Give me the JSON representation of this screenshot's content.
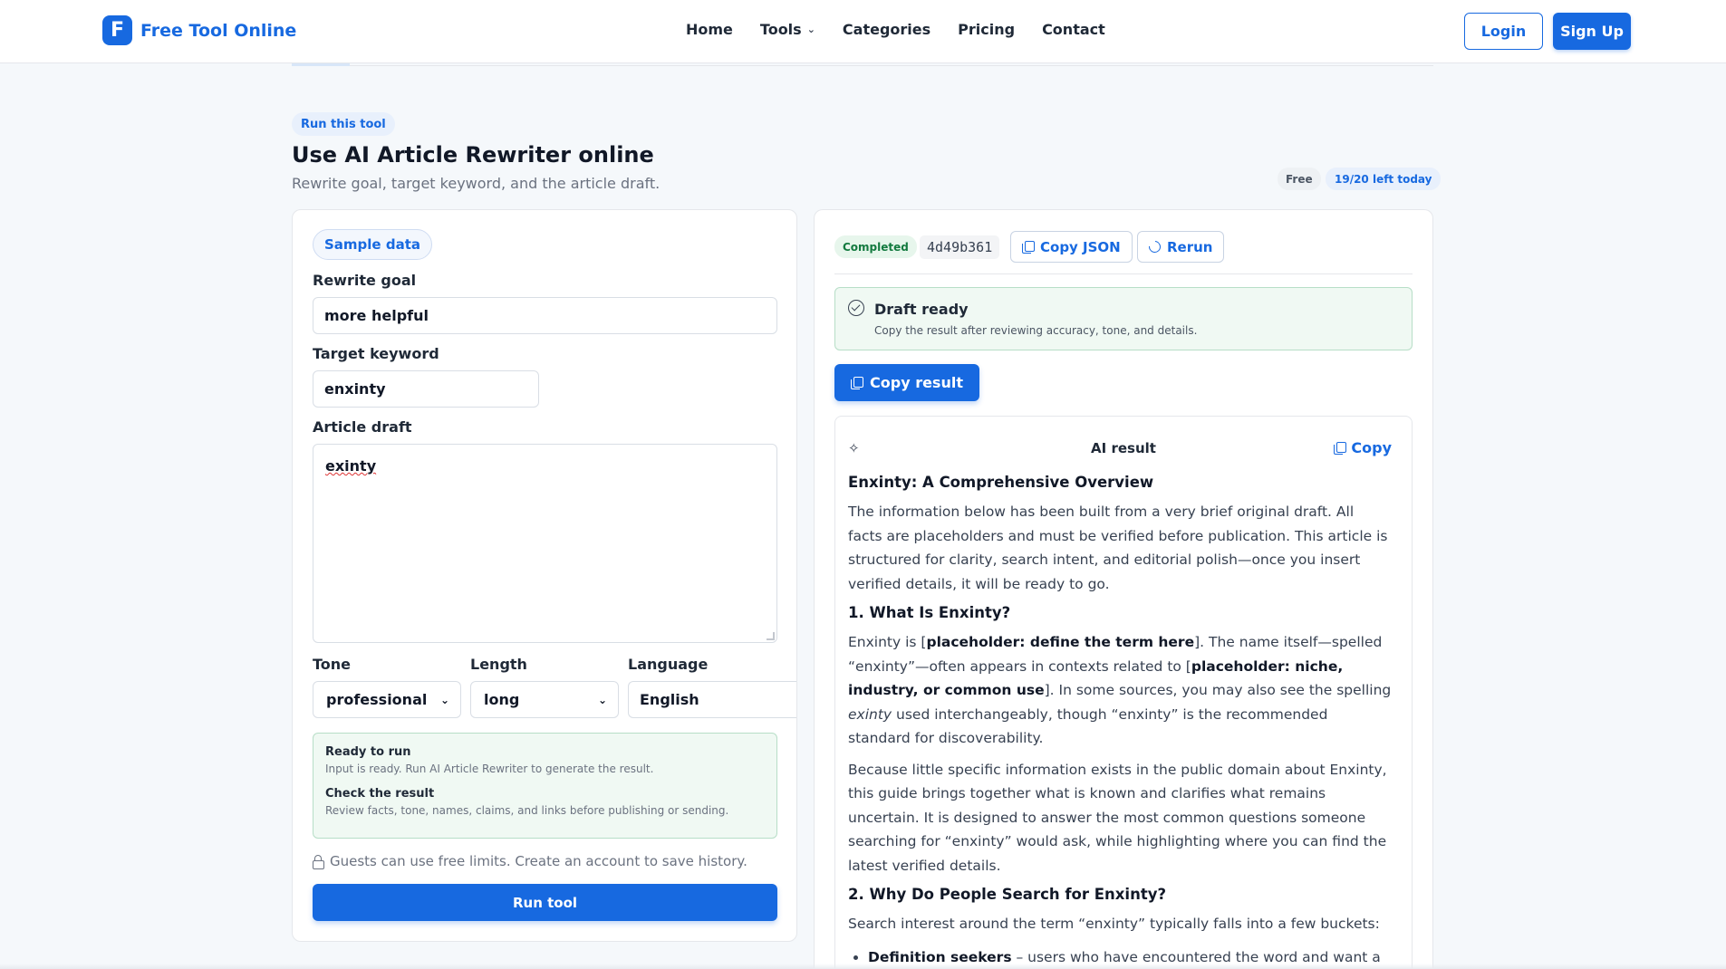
{
  "header": {
    "brand_letter": "F",
    "brand_name": "Free Tool Online",
    "nav": [
      {
        "label": "Home"
      },
      {
        "label": "Tools"
      },
      {
        "label": "Categories"
      },
      {
        "label": "Pricing"
      },
      {
        "label": "Contact"
      }
    ],
    "login_label": "Login",
    "signup_label": "Sign Up"
  },
  "hero": {
    "pill": "Run this tool",
    "title": "Use AI Article Rewriter online",
    "subtitle": "Rewrite goal, target keyword, and the article draft.",
    "badge_free": "Free",
    "badge_left": "19/20 left today"
  },
  "form": {
    "sample_label": "Sample data",
    "rewrite_goal_label": "Rewrite goal",
    "rewrite_goal_value": "more helpful",
    "target_keyword_label": "Target keyword",
    "target_keyword_value": "enxinty",
    "article_draft_label": "Article draft",
    "article_draft_value": "exinty",
    "tone_label": "Tone",
    "tone_value": "professional",
    "length_label": "Length",
    "length_value": "long",
    "language_label": "Language",
    "language_value": "English",
    "info_ready_title": "Ready to run",
    "info_ready_text": "Input is ready. Run AI Article Rewriter to generate the result.",
    "info_check_title": "Check the result",
    "info_check_text": "Review facts, tone, names, claims, and links before publishing or sending.",
    "guest_note": "Guests can use free limits. Create an account to save history.",
    "run_label": "Run tool"
  },
  "result": {
    "status": "Completed",
    "run_id": "4d49b361",
    "copy_json_label": "Copy JSON",
    "rerun_label": "Rerun",
    "draft_title": "Draft ready",
    "draft_text": "Copy the result after reviewing accuracy, tone, and details.",
    "copy_result_label": "Copy result",
    "card_title": "AI result",
    "card_copy_label": "Copy",
    "article": {
      "h1": "Enxinty: A Comprehensive Overview",
      "intro": "The information below has been built from a very brief original draft. All facts are placeholders and must be verified before publication. This article is structured for clarity, search intent, and editorial polish—once you insert verified details, it will be ready to go.",
      "s1_title": "1. What Is Enxinty?",
      "s1_p1_a": "Enxinty is [",
      "s1_p1_b": "placeholder: define the term here",
      "s1_p1_c": "]. The name itself—spelled “enxinty”—often appears in contexts related to [",
      "s1_p1_d": "placeholder: niche, industry, or common use",
      "s1_p1_e": "]. In some sources, you may also see the spelling ",
      "s1_p1_f": "exinty",
      "s1_p1_g": " used interchangeably, though “enxinty” is the recommended standard for discoverability.",
      "s1_p2": "Because little specific information exists in the public domain about Enxinty, this guide brings together what is known and clarifies what remains uncertain. It is designed to answer the most common questions someone searching for “enxinty” would ask, while highlighting where you can find the latest verified details.",
      "s2_title": "2. Why Do People Search for Enxinty?",
      "s2_p1": "Search interest around the term “enxinty” typically falls into a few buckets:",
      "li1_b": "Definition seekers",
      "li1_t": " – users who have encountered the word and want a clear, reliable explanation."
    }
  }
}
